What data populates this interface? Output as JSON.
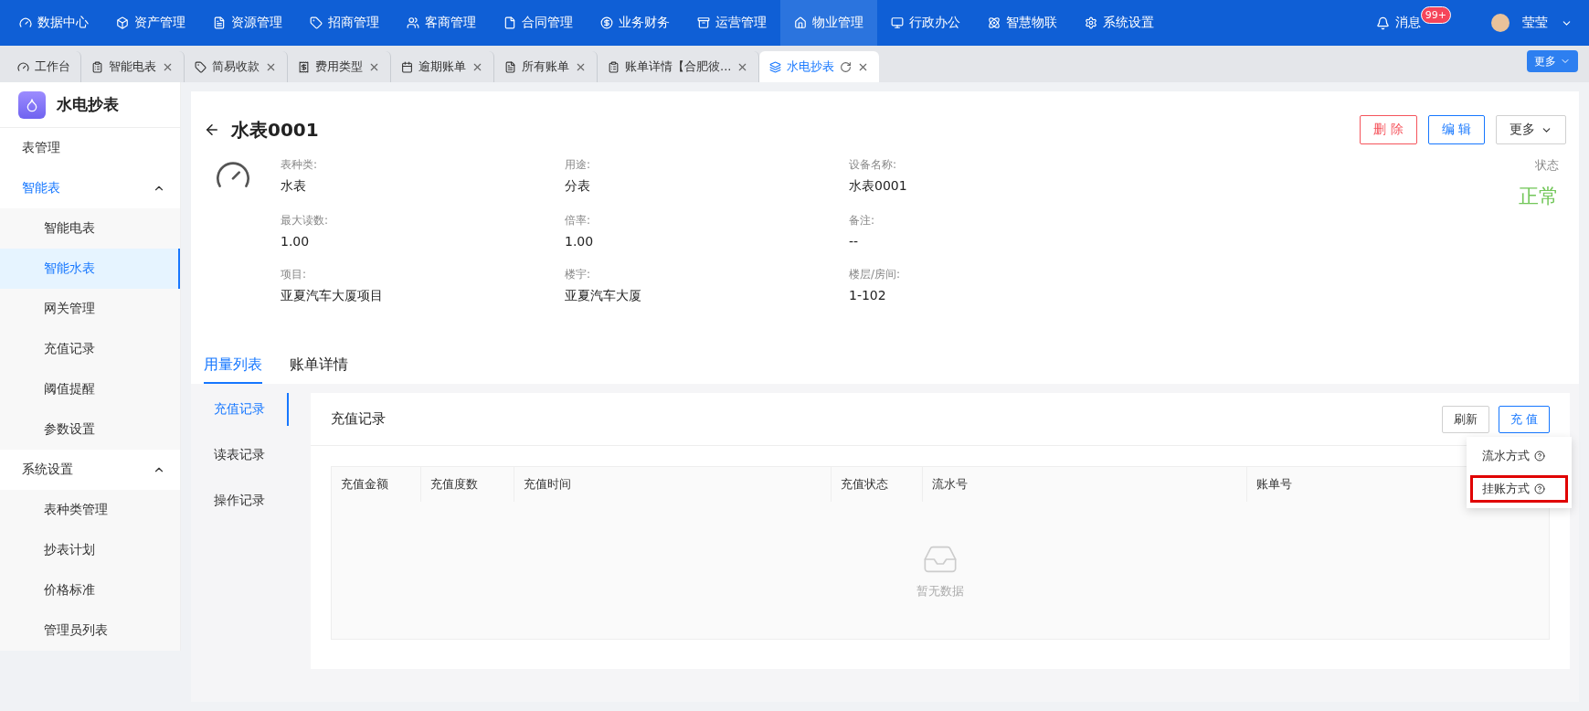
{
  "top_nav": {
    "items": [
      {
        "label": "数据中心",
        "selected": false
      },
      {
        "label": "资产管理",
        "selected": false
      },
      {
        "label": "资源管理",
        "selected": false
      },
      {
        "label": "招商管理",
        "selected": false
      },
      {
        "label": "客商管理",
        "selected": false
      },
      {
        "label": "合同管理",
        "selected": false
      },
      {
        "label": "业务财务",
        "selected": false
      },
      {
        "label": "运营管理",
        "selected": false
      },
      {
        "label": "物业管理",
        "selected": true
      },
      {
        "label": "行政办公",
        "selected": false
      },
      {
        "label": "智慧物联",
        "selected": false
      },
      {
        "label": "系统设置",
        "selected": false
      }
    ],
    "messages": {
      "label": "消息",
      "badge": "99+"
    },
    "user": {
      "name": "莹莹"
    }
  },
  "page_tabs": {
    "items": [
      {
        "label": "工作台",
        "closable": false,
        "selected": false
      },
      {
        "label": "智能电表",
        "closable": true,
        "selected": false
      },
      {
        "label": "简易收款",
        "closable": true,
        "selected": false
      },
      {
        "label": "费用类型",
        "closable": true,
        "selected": false
      },
      {
        "label": "逾期账单",
        "closable": true,
        "selected": false
      },
      {
        "label": "所有账单",
        "closable": true,
        "selected": false
      },
      {
        "label": "账单详情【合肥彼...",
        "closable": true,
        "selected": false
      },
      {
        "label": "水电抄表",
        "closable": true,
        "selected": true
      }
    ],
    "more": "更多"
  },
  "sidebar": {
    "title": "水电抄表",
    "items": [
      {
        "label": "表管理",
        "selected": false
      },
      {
        "label": "智能表",
        "expanded": true,
        "selected": true,
        "children": [
          {
            "label": "智能电表",
            "selected": false
          },
          {
            "label": "智能水表",
            "selected": true
          },
          {
            "label": "网关管理",
            "selected": false
          },
          {
            "label": "充值记录",
            "selected": false
          },
          {
            "label": "阈值提醒",
            "selected": false
          },
          {
            "label": "参数设置",
            "selected": false
          }
        ]
      },
      {
        "label": "系统设置",
        "expanded": true,
        "selected": false,
        "children": [
          {
            "label": "表种类管理",
            "selected": false
          },
          {
            "label": "抄表计划",
            "selected": false
          },
          {
            "label": "价格标准",
            "selected": false
          },
          {
            "label": "管理员列表",
            "selected": false
          }
        ]
      }
    ]
  },
  "detail": {
    "title": "水表0001",
    "buttons": [
      {
        "label": "删 除",
        "kind": "danger"
      },
      {
        "label": "编 辑",
        "kind": "primary"
      },
      {
        "label": "更多",
        "kind": "dropdown"
      }
    ],
    "fields": [
      {
        "label": "表种类:",
        "value": "水表"
      },
      {
        "label": "用途:",
        "value": "分表"
      },
      {
        "label": "设备名称:",
        "value": "水表0001"
      },
      {
        "label": "最大读数:",
        "value": "1.00"
      },
      {
        "label": "倍率:",
        "value": "1.00"
      },
      {
        "label": "备注:",
        "value": "--"
      },
      {
        "label": "项目:",
        "value": "亚夏汽车大厦项目"
      },
      {
        "label": "楼宇:",
        "value": "亚夏汽车大厦"
      },
      {
        "label": "楼层/房间:",
        "value": "1-102"
      }
    ],
    "status": {
      "label": "状态",
      "value": "正常"
    }
  },
  "detail_tabs": [
    {
      "label": "用量列表",
      "selected": true
    },
    {
      "label": "账单详情",
      "selected": false
    }
  ],
  "record_tabs": [
    {
      "label": "充值记录",
      "selected": true
    },
    {
      "label": "读表记录",
      "selected": false
    },
    {
      "label": "操作记录",
      "selected": false
    }
  ],
  "records": {
    "title": "充值记录",
    "buttons": [
      {
        "label": "刷新",
        "kind": "default"
      },
      {
        "label": "充 值",
        "kind": "primary"
      }
    ],
    "table": {
      "columns": [
        "充值金额",
        "充值度数",
        "充值时间",
        "充值状态",
        "流水号",
        "账单号"
      ],
      "empty": "暂无数据"
    },
    "menu": [
      {
        "label": "流水方式",
        "highlighted": false
      },
      {
        "label": "挂账方式",
        "highlighted": true
      }
    ]
  }
}
